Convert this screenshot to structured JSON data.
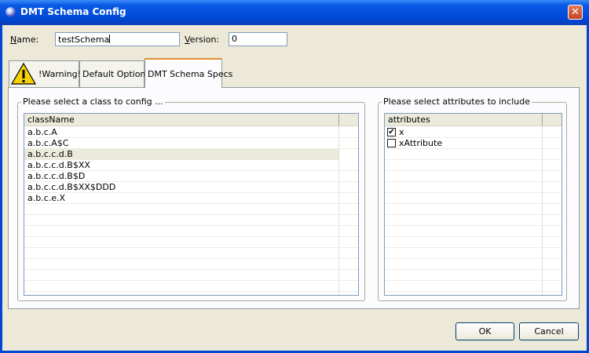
{
  "window": {
    "title": "DMT Schema Config",
    "close_glyph": "✕"
  },
  "form": {
    "name_label_key": "N",
    "name_label_rest": "ame:",
    "name_value": "testSchema",
    "version_label_key": "V",
    "version_label_rest": "ersion:",
    "version_value": "0"
  },
  "tabs": [
    {
      "label": "!Warning!",
      "icon": "warning-icon"
    },
    {
      "label": "Default Options"
    },
    {
      "label": "DMT Schema Specs",
      "active": true
    }
  ],
  "class_panel": {
    "title": "Please select a class to config ...",
    "column": "className",
    "rows": [
      "a.b.c.A",
      "a.b.c.A$C",
      "a.b.c.c.d.B",
      "a.b.c.c.d.B$XX",
      "a.b.c.c.d.B$D",
      "a.b.c.c.d.B$XX$DDD",
      "a.b.c.e.X"
    ],
    "selected_index": 2
  },
  "attr_panel": {
    "title": "Please select attributes to include",
    "column": "attributes",
    "rows": [
      {
        "label": "x",
        "checked": true
      },
      {
        "label": "xAttribute",
        "checked": false
      }
    ]
  },
  "buttons": {
    "ok": "OK",
    "cancel": "Cancel"
  },
  "colors": {
    "title_bar": "#0047d4",
    "dialog_bg": "#ece9d8",
    "selection": "#ebeadb"
  }
}
